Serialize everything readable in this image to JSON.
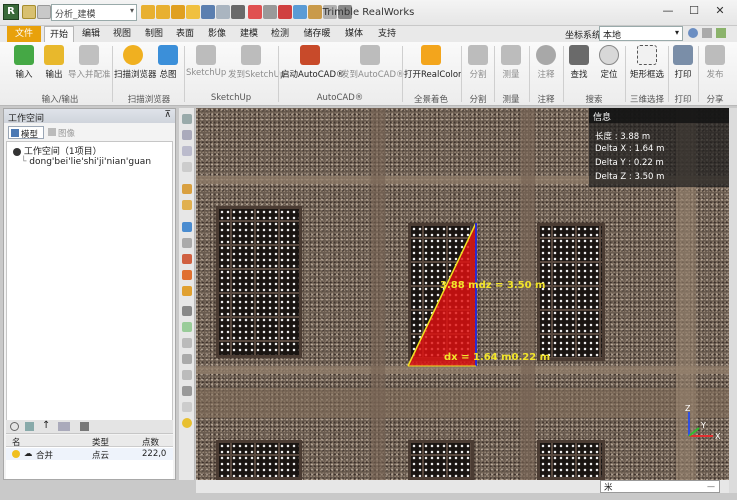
{
  "titlebar": {
    "app_icon_glyph": "R",
    "quick_access_combo": "分析_建模",
    "window_title": "Trimble RealWorks",
    "min": "—",
    "max": "☐",
    "close": "✕"
  },
  "tabs": {
    "file": "文件",
    "items": [
      "开始",
      "编辑",
      "视图",
      "制图",
      "表面",
      "影像",
      "建模",
      "检测",
      "储存暖",
      "媒体",
      "支持"
    ],
    "active": "开始",
    "coord_label": "坐标系统",
    "coord_value": "本地"
  },
  "ribbon": {
    "buttons": {
      "input": "输入",
      "output": "输出",
      "import_registration": "导入并配准",
      "scan_explorer": "扫描浏览器",
      "overview": "总图",
      "sketchup": "SketchUp",
      "send_sketchup": "发到SketchUp",
      "launch_autocad": "启动AutoCAD®",
      "send_autocad": "发到AutoCAD®",
      "open_realcolor": "打开RealColor",
      "segment": "分割",
      "measure": "测量",
      "annotate": "注释",
      "find": "查找",
      "locate": "定位",
      "rect_select": "矩形框选",
      "print": "打印",
      "publish": "发布"
    },
    "groups": {
      "io": "输入/输出",
      "scan": "扫描浏览器",
      "sketchup": "SketchUp",
      "autocad": "AutoCAD®",
      "color": "全景着色",
      "segment": "分割",
      "measure": "测量",
      "annotate": "注释",
      "search": "搜索",
      "select3d": "三维选择",
      "print": "打印",
      "share": "分享"
    }
  },
  "left_panel": {
    "header": "工作空间",
    "pin": "⊼",
    "model_tab": "模型",
    "image_tab": "图像",
    "tree_root": "工作空间（1项目）",
    "tree_child": "dong'bei'lie'shi'ji'nian'guan",
    "table_headers": [
      "名",
      "类型",
      "点数"
    ],
    "rows": [
      {
        "name": "合并",
        "type": "点云",
        "points": "222,0"
      }
    ]
  },
  "viewport": {
    "info_title": "信息",
    "info_lines": [
      "长度 : 3.88 m",
      "Delta X : 1.64 m",
      "Delta Y : 0.22 m",
      "Delta Z : 3.50 m"
    ],
    "measure_label_top": "3.88 mdz = 3.50 m",
    "measure_label_bottom": "dx = 1.64 m0.22 m",
    "axis_x": "X",
    "axis_y": "Y",
    "axis_z": "Z",
    "unit": "米",
    "colors": {
      "triangle": "#e01010",
      "measure_line": "#f0e020",
      "vertical_edge": "#2b2bd0",
      "label_text": "#f2e52a"
    }
  }
}
